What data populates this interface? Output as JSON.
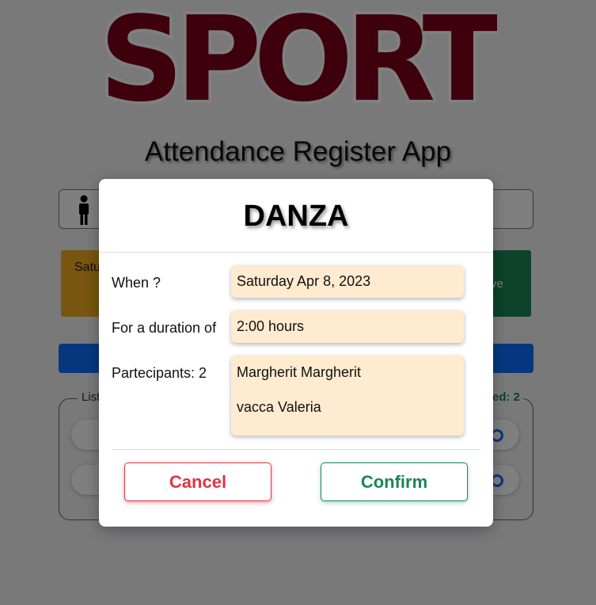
{
  "header": {
    "logo_text": "SPORT",
    "app_title": "Attendance Register App"
  },
  "background": {
    "date_card_text": "Satu Ap 20",
    "green_card_text": "ve",
    "list_legend": "List",
    "checked_legend": "ed: 2"
  },
  "modal": {
    "title": "DANZA",
    "when_label": "When ?",
    "when_value": "Saturday Apr 8, 2023",
    "duration_label": "For a duration of",
    "duration_value": "2:00 hours",
    "participants_label": "Partecipants: 2",
    "participants": [
      "Margherit Margherit",
      "vacca Valeria"
    ],
    "cancel_label": "Cancel",
    "confirm_label": "Confirm"
  },
  "colors": {
    "logo": "#7a0019",
    "cancel": "#dc3545",
    "confirm": "#198754",
    "field_bg": "#feebd0",
    "primary": "#0d6efd",
    "warning": "#f0ad1e"
  }
}
